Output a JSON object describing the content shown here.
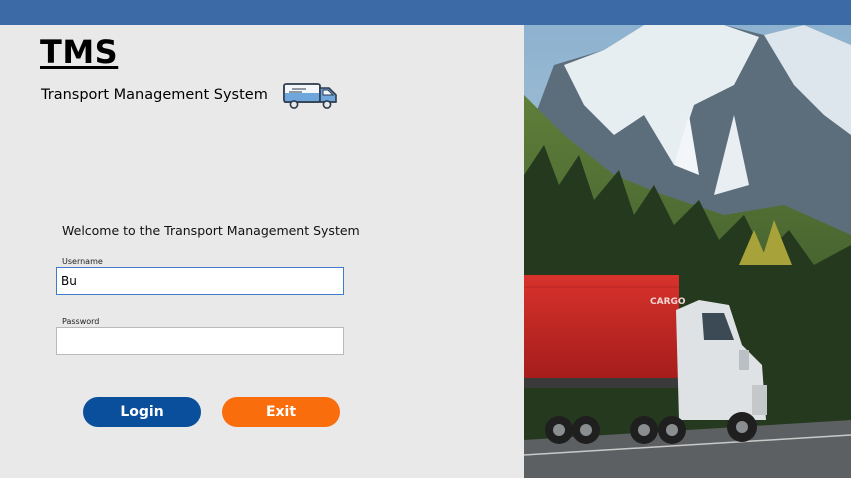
{
  "app": {
    "title": "TMS",
    "subtitle": "Transport Management System"
  },
  "login": {
    "welcome": "Welcome to the Transport Management System",
    "username_label": "Username",
    "username_value": "Bu",
    "password_label": "Password",
    "password_value": "",
    "login_label": "Login",
    "exit_label": "Exit"
  },
  "truck_photo": {
    "trailer_text": "CARGO"
  },
  "icons": {
    "truck": "truck-icon"
  },
  "colors": {
    "titlebar": "#3b6aa6",
    "login_button": "#0a4f9b",
    "exit_button": "#fa6d0c",
    "background": "#e9e9e9"
  }
}
